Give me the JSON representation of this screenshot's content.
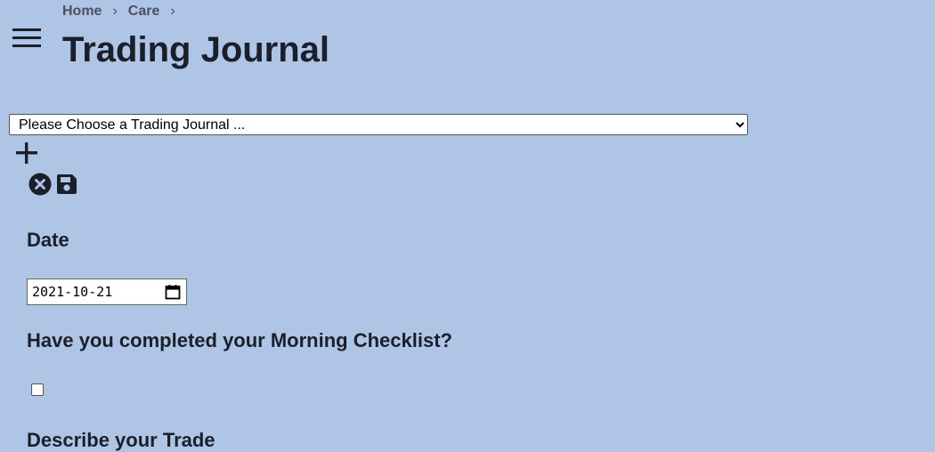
{
  "breadcrumb": {
    "items": [
      "Home",
      "Care"
    ],
    "separator": "›"
  },
  "header": {
    "title": "Trading Journal",
    "menu_icon": "hamburger-menu-icon"
  },
  "journal_select": {
    "selected": "Please Choose a Trading Journal ..."
  },
  "toolbar": {
    "add_icon": "plus-icon",
    "cancel_icon": "close-circle-icon",
    "save_icon": "save-floppy-icon"
  },
  "form": {
    "date_label": "Date",
    "date_value": "2021-10-21",
    "checklist_label": "Have you completed your Morning Checklist?",
    "checklist_checked": false,
    "describe_label": "Describe your Trade"
  },
  "colors": {
    "background": "#afc5e5",
    "text": "#1b1f2a",
    "breadcrumb": "#4a5160"
  }
}
